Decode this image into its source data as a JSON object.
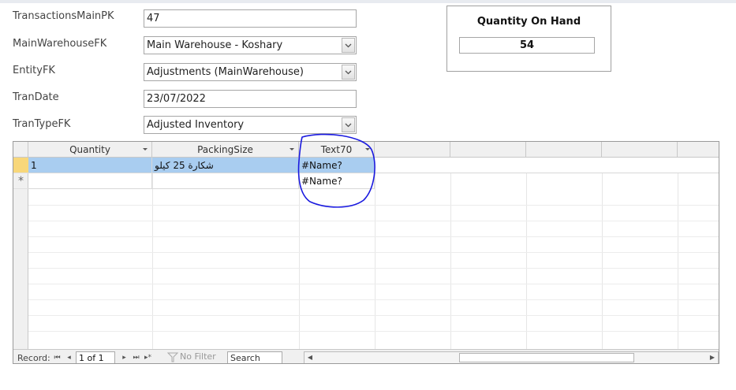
{
  "form": {
    "fields": [
      {
        "label": "TransactionsMainPK",
        "value": "47",
        "type": "text"
      },
      {
        "label": "MainWarehouseFK",
        "value": "Main Warehouse - Koshary",
        "type": "combo"
      },
      {
        "label": "EntityFK",
        "value": "Adjustments (MainWarehouse)",
        "type": "combo"
      },
      {
        "label": "TranDate",
        "value": "23/07/2022",
        "type": "text"
      },
      {
        "label": "TranTypeFK",
        "value": "Adjusted Inventory",
        "type": "combo"
      }
    ]
  },
  "quantity_on_hand": {
    "title": "Quantity On Hand",
    "value": "54"
  },
  "datasheet": {
    "columns": [
      {
        "label": "Quantity",
        "has_dropdown": true
      },
      {
        "label": "PackingSize",
        "has_dropdown": true
      },
      {
        "label": "Text70",
        "has_dropdown": true
      }
    ],
    "rows": [
      {
        "quantity": "1",
        "packing_size": "شكارة 25 كيلو",
        "text70": "#Name?"
      }
    ],
    "new_row": {
      "marker": "*",
      "text70": "#Name?"
    }
  },
  "navigation": {
    "record_label": "Record:",
    "record_position": "1 of 1",
    "filter_label": "No Filter",
    "search_placeholder": "Search"
  },
  "colors": {
    "selected_row": "#a9cdf0",
    "current_row_marker": "#f8d77a",
    "annotation_circle": "#1a1adf"
  }
}
